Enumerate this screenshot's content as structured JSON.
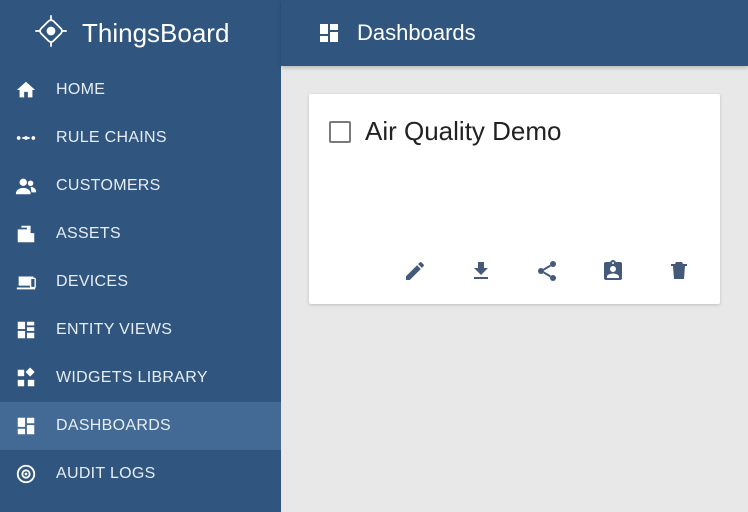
{
  "brand": {
    "title": "ThingsBoard"
  },
  "sidebar": {
    "items": [
      {
        "label": "HOME",
        "icon": "home-icon"
      },
      {
        "label": "RULE CHAINS",
        "icon": "rule-chains-icon"
      },
      {
        "label": "CUSTOMERS",
        "icon": "customers-icon"
      },
      {
        "label": "ASSETS",
        "icon": "assets-icon"
      },
      {
        "label": "DEVICES",
        "icon": "devices-icon"
      },
      {
        "label": "ENTITY VIEWS",
        "icon": "entity-views-icon"
      },
      {
        "label": "WIDGETS LIBRARY",
        "icon": "widgets-library-icon"
      },
      {
        "label": "DASHBOARDS",
        "icon": "dashboards-icon",
        "active": true
      },
      {
        "label": "AUDIT LOGS",
        "icon": "audit-logs-icon"
      }
    ]
  },
  "topbar": {
    "title": "Dashboards",
    "icon": "dashboards-icon"
  },
  "dashboard_card": {
    "title": "Air Quality Demo",
    "checked": false,
    "actions": [
      {
        "name": "edit",
        "icon": "pencil-icon"
      },
      {
        "name": "export",
        "icon": "download-icon"
      },
      {
        "name": "share",
        "icon": "share-icon"
      },
      {
        "name": "assign",
        "icon": "assign-icon"
      },
      {
        "name": "delete",
        "icon": "trash-icon"
      }
    ]
  }
}
